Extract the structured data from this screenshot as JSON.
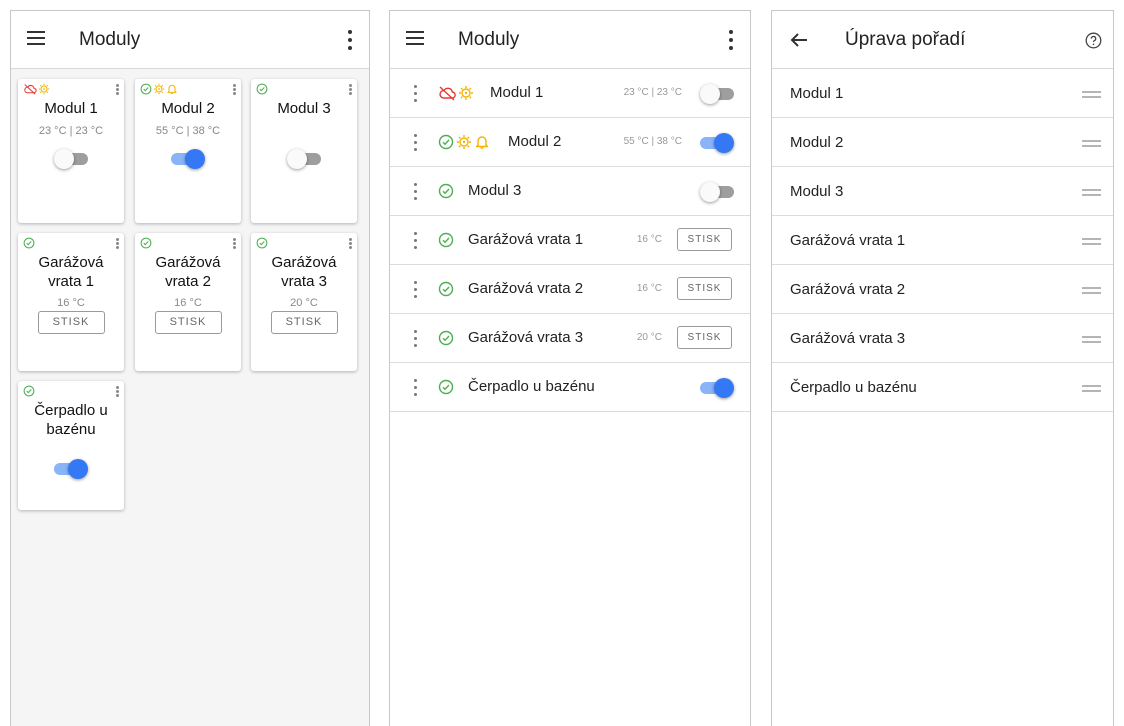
{
  "colors": {
    "accent": "#3478f6",
    "accent_light": "#8ab4f8",
    "ok": "#4caf50",
    "error": "#e53935",
    "warning": "#f4b400"
  },
  "grid_screen": {
    "title": "Moduly",
    "cards": [
      {
        "name": "Modul 1",
        "temp": "23 °C | 23 °C",
        "status_icons": [
          "cloud-off-icon",
          "sun-warning-icon"
        ],
        "control": "toggle",
        "on": false
      },
      {
        "name": "Modul 2",
        "temp": "55 °C | 38 °C",
        "status_icons": [
          "check-circle-icon",
          "sun-warning-icon",
          "bell-icon"
        ],
        "control": "toggle",
        "on": true
      },
      {
        "name": "Modul 3",
        "temp": "",
        "status_icons": [
          "check-circle-icon"
        ],
        "control": "toggle",
        "on": false
      },
      {
        "name": "Garážová vrata 1",
        "temp": "16 °C",
        "status_icons": [
          "check-circle-icon"
        ],
        "control": "button",
        "button_label": "STISK"
      },
      {
        "name": "Garážová vrata 2",
        "temp": "16 °C",
        "status_icons": [
          "check-circle-icon"
        ],
        "control": "button",
        "button_label": "STISK"
      },
      {
        "name": "Garážová vrata 3",
        "temp": "20 °C",
        "status_icons": [
          "check-circle-icon"
        ],
        "control": "button",
        "button_label": "STISK"
      },
      {
        "name": "Čerpadlo u bazénu",
        "temp": "",
        "status_icons": [
          "check-circle-icon"
        ],
        "control": "toggle",
        "on": true
      }
    ]
  },
  "list_screen": {
    "title": "Moduly",
    "rows": [
      {
        "name": "Modul 1",
        "temp": "23 °C | 23 °C",
        "status_icons": [
          "cloud-off-icon",
          "sun-warning-icon"
        ],
        "control": "toggle",
        "on": false
      },
      {
        "name": "Modul 2",
        "temp": "55 °C | 38 °C",
        "status_icons": [
          "check-circle-icon",
          "sun-warning-icon",
          "bell-icon"
        ],
        "control": "toggle",
        "on": true
      },
      {
        "name": "Modul 3",
        "temp": "",
        "status_icons": [
          "check-circle-icon"
        ],
        "control": "toggle",
        "on": false
      },
      {
        "name": "Garážová vrata 1",
        "temp": "16 °C",
        "status_icons": [
          "check-circle-icon"
        ],
        "control": "button",
        "button_label": "STISK"
      },
      {
        "name": "Garážová vrata 2",
        "temp": "16 °C",
        "status_icons": [
          "check-circle-icon"
        ],
        "control": "button",
        "button_label": "STISK"
      },
      {
        "name": "Garážová vrata 3",
        "temp": "20 °C",
        "status_icons": [
          "check-circle-icon"
        ],
        "control": "button",
        "button_label": "STISK"
      },
      {
        "name": "Čerpadlo u bazénu",
        "temp": "",
        "status_icons": [
          "check-circle-icon"
        ],
        "control": "toggle",
        "on": true
      }
    ]
  },
  "reorder_screen": {
    "title": "Úprava pořadí",
    "items": [
      "Modul 1",
      "Modul 2",
      "Modul 3",
      "Garážová vrata 1",
      "Garážová vrata 2",
      "Garážová vrata 3",
      "Čerpadlo u bazénu"
    ]
  }
}
